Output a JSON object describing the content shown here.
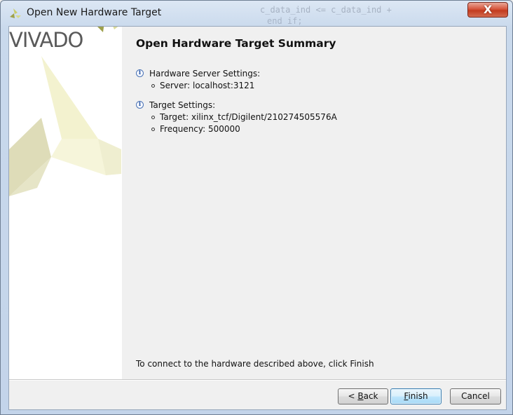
{
  "window": {
    "title": "Open New Hardware Target",
    "close_glyph": "X",
    "background_code_lines": [
      "c_data_ind <= c_data_ind +",
      "end if;"
    ]
  },
  "side_panel": {
    "logo_text": "VIVADO",
    "logo_mark": "."
  },
  "summary": {
    "title": "Open Hardware Target Summary",
    "sections": [
      {
        "icon": "info-icon",
        "heading": "Hardware Server Settings:",
        "items": [
          "Server: localhost:3121"
        ]
      },
      {
        "icon": "info-icon",
        "heading": "Target Settings:",
        "items": [
          "Target: xilinx_tcf/Digilent/210274505576A",
          "Frequency: 500000"
        ]
      }
    ],
    "footer_message": "To connect to the hardware described above, click Finish"
  },
  "buttons": {
    "back": {
      "prefix": "< ",
      "mnemonic": "B",
      "rest": "ack"
    },
    "finish": {
      "prefix": "",
      "mnemonic": "F",
      "rest": "inish"
    },
    "cancel": {
      "label": "Cancel"
    }
  },
  "colors": {
    "accent_yellow": "#e8e7b0",
    "accent_olive": "#c3c47a",
    "logo_gray": "#5a5a5a",
    "info_blue": "#2d5aa6"
  }
}
